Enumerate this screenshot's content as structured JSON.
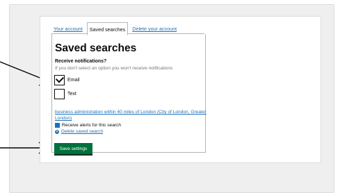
{
  "tabs": [
    {
      "label": "Your account",
      "active": false
    },
    {
      "label": "Saved searches",
      "active": true
    },
    {
      "label": "Delete your account",
      "active": false
    }
  ],
  "page_title": "Saved searches",
  "notifications": {
    "title": "Receive notifications?",
    "hint": "If you don't select an option you won't receive notifications",
    "options": [
      {
        "label": "Email",
        "checked": true
      },
      {
        "label": "Text",
        "checked": false
      }
    ]
  },
  "search": {
    "link_text": "business administration within 40 miles of London (City of London, Greater London)",
    "alerts_label": "Receive alerts for this search",
    "delete_label": "Delete saved search"
  },
  "save_button": "Save settings",
  "colors": {
    "link": "#1d70b8",
    "button": "#00703c"
  }
}
